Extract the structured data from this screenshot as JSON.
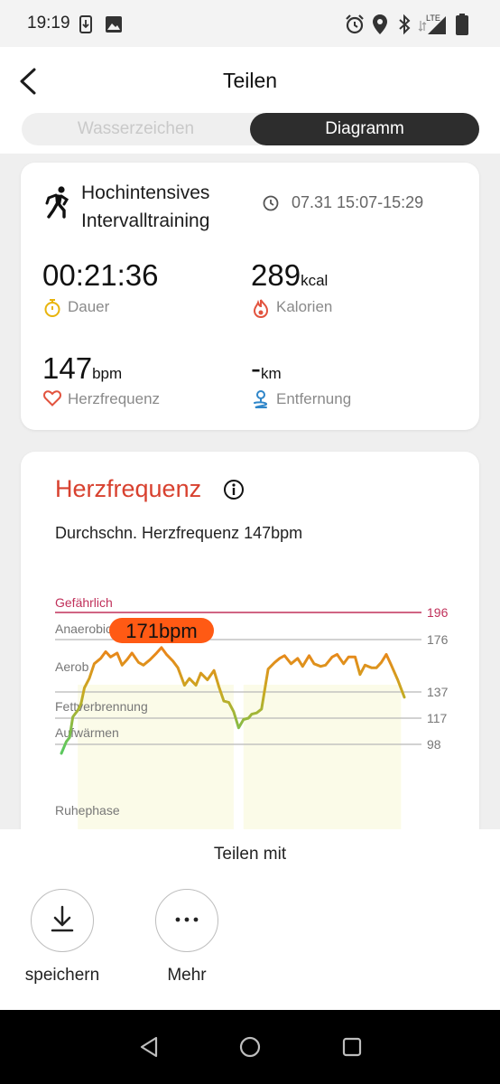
{
  "status_bar": {
    "time": "19:19",
    "left_icons": [
      "download-notification-icon",
      "image-notification-icon"
    ],
    "right_icons": [
      "alarm-icon",
      "location-icon",
      "bluetooth-icon",
      "lte-signal-icon",
      "battery-icon"
    ],
    "network": "LTE"
  },
  "header": {
    "title": "Teilen",
    "back_icon": "chevron-left-icon"
  },
  "segmented_control": {
    "options": [
      "Wasserzeichen",
      "Diagramm"
    ],
    "selected": "Diagramm"
  },
  "workout": {
    "activity_name": "Hochintensives Intervalltraining",
    "activity_icon": "running-person-icon",
    "datetime": "07.31 15:07-15:29",
    "stats": {
      "duration": {
        "value": "00:21:36",
        "unit": "",
        "label": "Dauer",
        "icon": "stopwatch-icon",
        "color": "#e8b40c"
      },
      "calories": {
        "value": "289",
        "unit": "kcal",
        "label": "Kalorien",
        "icon": "flame-icon",
        "color": "#e2533e"
      },
      "heart_rate": {
        "value": "147",
        "unit": "bpm",
        "label": "Herzfrequenz",
        "icon": "heart-icon",
        "color": "#e2533e"
      },
      "distance": {
        "value": "-",
        "unit": "km",
        "label": "Entfernung",
        "icon": "route-icon",
        "color": "#2f86c9"
      }
    }
  },
  "heart_rate_card": {
    "title": "Herzfrequenz",
    "title_color": "#d8412f",
    "average_text": "Durchschn. Herzfrequenz 147bpm",
    "max_badge": "171bpm",
    "badge_color": "#ff5a14"
  },
  "chart_data": {
    "type": "line",
    "title": "Herzfrequenz",
    "zones": [
      {
        "name": "Gefährlich",
        "threshold": 196
      },
      {
        "name": "Anaerobica",
        "threshold": 176
      },
      {
        "name": "Aerob",
        "threshold": null
      },
      {
        "name": "Fettverbrennung",
        "threshold": 137
      },
      {
        "name": "Aufwärmen",
        "threshold": 117
      },
      {
        "name": "",
        "threshold": 98
      },
      {
        "name": "Ruhephase",
        "threshold": null
      }
    ],
    "y_ticks": [
      196,
      176,
      137,
      117,
      98
    ],
    "max_annotation": "171bpm",
    "y_scale": "piecewise-linear",
    "heart_rate_trace": [
      [
        0,
        97
      ],
      [
        0.3,
        100
      ],
      [
        0.5,
        103
      ],
      [
        0.7,
        118
      ],
      [
        1.0,
        123
      ],
      [
        1.2,
        128
      ],
      [
        1.4,
        140
      ],
      [
        1.7,
        147
      ],
      [
        2.0,
        158
      ],
      [
        2.4,
        162
      ],
      [
        2.7,
        167
      ],
      [
        3.0,
        163
      ],
      [
        3.4,
        166
      ],
      [
        3.7,
        157
      ],
      [
        4.0,
        161
      ],
      [
        4.3,
        166
      ],
      [
        4.7,
        159
      ],
      [
        5.0,
        157
      ],
      [
        5.4,
        161
      ],
      [
        5.8,
        166
      ],
      [
        6.1,
        170
      ],
      [
        6.4,
        165
      ],
      [
        6.8,
        160
      ],
      [
        7.1,
        155
      ],
      [
        7.5,
        142
      ],
      [
        7.8,
        147
      ],
      [
        8.2,
        142
      ],
      [
        8.5,
        151
      ],
      [
        8.9,
        146
      ],
      [
        9.3,
        153
      ],
      [
        9.6,
        141
      ],
      [
        9.9,
        130
      ],
      [
        10.2,
        129
      ],
      [
        10.5,
        122
      ],
      [
        10.8,
        110
      ],
      [
        11.1,
        116
      ],
      [
        11.4,
        117
      ],
      [
        11.6,
        120
      ],
      [
        11.9,
        121
      ],
      [
        12.2,
        124
      ],
      [
        12.6,
        154
      ],
      [
        13.0,
        159
      ],
      [
        13.3,
        162
      ],
      [
        13.6,
        164
      ],
      [
        14.0,
        158
      ],
      [
        14.4,
        162
      ],
      [
        14.7,
        156
      ],
      [
        15.1,
        164
      ],
      [
        15.4,
        158
      ],
      [
        15.8,
        156
      ],
      [
        16.1,
        157
      ],
      [
        16.5,
        163
      ],
      [
        16.8,
        165
      ],
      [
        17.2,
        158
      ],
      [
        17.5,
        163
      ],
      [
        17.9,
        163
      ],
      [
        18.2,
        150
      ],
      [
        18.5,
        157
      ],
      [
        18.9,
        155
      ],
      [
        19.2,
        155
      ],
      [
        19.5,
        159
      ],
      [
        19.8,
        165
      ],
      [
        20.1,
        157
      ],
      [
        20.5,
        146
      ],
      [
        20.9,
        133
      ]
    ],
    "shaded_intervals": [
      [
        1.0,
        10.5
      ],
      [
        11.1,
        20.7
      ]
    ]
  },
  "share": {
    "title": "Teilen mit",
    "buttons": [
      {
        "label": "speichern",
        "icon": "download-icon"
      },
      {
        "label": "Mehr",
        "icon": "more-dots-icon"
      }
    ]
  },
  "nav_bar": {
    "icons": [
      "back-triangle-icon",
      "home-circle-icon",
      "recents-square-icon"
    ]
  },
  "colors": {
    "dangerous_line": "#c0305a",
    "line_gradient": [
      "#5cc85e",
      "#c8aa22",
      "#ff6e14"
    ],
    "shaded_area": "#fbfbe8"
  }
}
